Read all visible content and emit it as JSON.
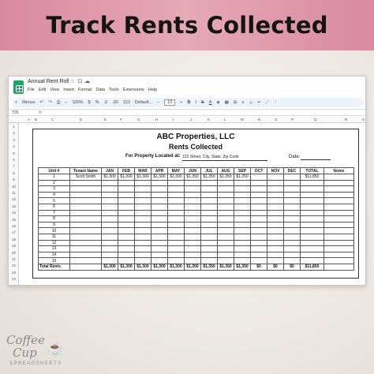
{
  "banner": {
    "title": "Track Rents Collected"
  },
  "window": {
    "doc_title": "Annual Rent Roll",
    "title_icons": [
      "star-icon",
      "folder-icon",
      "cloud-icon"
    ],
    "menu": [
      "File",
      "Edit",
      "View",
      "Insert",
      "Format",
      "Data",
      "Tools",
      "Extensions",
      "Help"
    ],
    "toolbar": {
      "menus_label": "Menus",
      "zoom": "100%",
      "currency": "$",
      "percent": "%",
      "decimal_dec": ".0",
      "decimal_inc": ".00",
      "format_123": "123",
      "font": "Default...",
      "font_size": "10",
      "bold": "B",
      "italic": "I",
      "strike": "S",
      "text_color": "A"
    },
    "formula_bar": {
      "cell_ref": "T35",
      "fx": "fx"
    },
    "column_headers": [
      "A",
      "B",
      "C",
      "D",
      "E",
      "F",
      "G",
      "H",
      "I",
      "J",
      "K",
      "L",
      "M",
      "N",
      "O",
      "P",
      "Q",
      "R",
      "S"
    ],
    "row_headers": [
      "1",
      "2",
      "3",
      "4",
      "5",
      "6",
      "7",
      "8",
      "9",
      "10",
      "11",
      "12",
      "13",
      "14",
      "15",
      "16",
      "17",
      "18",
      "19",
      "20",
      "21",
      "22",
      "23",
      "24"
    ]
  },
  "sheet": {
    "company": "ABC Properties, LLC",
    "subtitle": "Rents Collected",
    "located_label": "For Property Located at:",
    "located_value": "123 Street, City, State, Zip Code",
    "date_label": "Date:",
    "table": {
      "headers": [
        "Unit #",
        "Tenant Name",
        "JAN",
        "FEB",
        "MAR",
        "APR",
        "MAY",
        "JUN",
        "JUL",
        "AUG",
        "SEP",
        "OCT",
        "NOV",
        "DEC",
        "TOTAL",
        "Notes"
      ],
      "rows": [
        [
          "1",
          "Scott Smith",
          "$1,300",
          "$1,300",
          "$1,300",
          "$1,300",
          "$1,300",
          "$1,350",
          "$1,350",
          "$1,350",
          "$1,350",
          "",
          "",
          "",
          "$11,850",
          ""
        ],
        [
          "2",
          "",
          "",
          "",
          "",
          "",
          "",
          "",
          "",
          "",
          "",
          "",
          "",
          "",
          "",
          ""
        ],
        [
          "3",
          "",
          "",
          "",
          "",
          "",
          "",
          "",
          "",
          "",
          "",
          "",
          "",
          "",
          "",
          ""
        ],
        [
          "4",
          "",
          "",
          "",
          "",
          "",
          "",
          "",
          "",
          "",
          "",
          "",
          "",
          "",
          "",
          ""
        ],
        [
          "5",
          "",
          "",
          "",
          "",
          "",
          "",
          "",
          "",
          "",
          "",
          "",
          "",
          "",
          "",
          ""
        ],
        [
          "6",
          "",
          "",
          "",
          "",
          "",
          "",
          "",
          "",
          "",
          "",
          "",
          "",
          "",
          "",
          ""
        ],
        [
          "7",
          "",
          "",
          "",
          "",
          "",
          "",
          "",
          "",
          "",
          "",
          "",
          "",
          "",
          "",
          ""
        ],
        [
          "8",
          "",
          "",
          "",
          "",
          "",
          "",
          "",
          "",
          "",
          "",
          "",
          "",
          "",
          "",
          ""
        ],
        [
          "9",
          "",
          "",
          "",
          "",
          "",
          "",
          "",
          "",
          "",
          "",
          "",
          "",
          "",
          "",
          ""
        ],
        [
          "10",
          "",
          "",
          "",
          "",
          "",
          "",
          "",
          "",
          "",
          "",
          "",
          "",
          "",
          "",
          ""
        ],
        [
          "11",
          "",
          "",
          "",
          "",
          "",
          "",
          "",
          "",
          "",
          "",
          "",
          "",
          "",
          "",
          ""
        ],
        [
          "12",
          "",
          "",
          "",
          "",
          "",
          "",
          "",
          "",
          "",
          "",
          "",
          "",
          "",
          "",
          ""
        ],
        [
          "13",
          "",
          "",
          "",
          "",
          "",
          "",
          "",
          "",
          "",
          "",
          "",
          "",
          "",
          "",
          ""
        ],
        [
          "14",
          "",
          "",
          "",
          "",
          "",
          "",
          "",
          "",
          "",
          "",
          "",
          "",
          "",
          "",
          ""
        ],
        [
          "15",
          "",
          "",
          "",
          "",
          "",
          "",
          "",
          "",
          "",
          "",
          "",
          "",
          "",
          "",
          ""
        ]
      ],
      "total_row": [
        "Total Rents",
        "",
        "$1,300",
        "$1,300",
        "$1,300",
        "$1,300",
        "$1,300",
        "$1,350",
        "$1,350",
        "$1,350",
        "$1,350",
        "$0",
        "$0",
        "$0",
        "$11,850",
        ""
      ]
    }
  },
  "logo": {
    "line1": "Coffee",
    "line2": "Cup",
    "brand": "SPREADSHEETS"
  },
  "colors": {
    "banner": "#e0a0b2",
    "sheets_green": "#1ea362",
    "logo_pink": "#d6799a"
  }
}
